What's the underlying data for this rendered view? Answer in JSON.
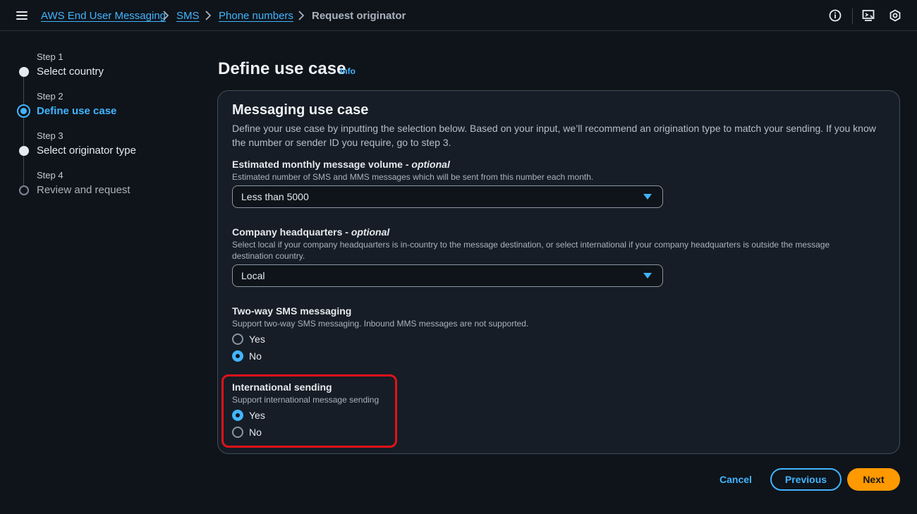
{
  "breadcrumb": {
    "items": [
      "AWS End User Messaging",
      "SMS",
      "Phone numbers"
    ],
    "current": "Request originator"
  },
  "topbar_icons": [
    "info-icon",
    "cloudshell-icon",
    "settings-icon"
  ],
  "steps": [
    {
      "step": "Step 1",
      "title": "Select country",
      "state": "completed"
    },
    {
      "step": "Step 2",
      "title": "Define use case",
      "state": "active"
    },
    {
      "step": "Step 3",
      "title": "Select originator type",
      "state": "completed"
    },
    {
      "step": "Step 4",
      "title": "Review and request",
      "state": "pending"
    }
  ],
  "page": {
    "title": "Define use case",
    "info": "Info"
  },
  "panel": {
    "title": "Messaging use case",
    "description": "Define your use case by inputting the selection below. Based on your input, we’ll recommend an origination type to match your sending. If you know the number or sender ID you require, go to step 3.",
    "volume": {
      "label": "Estimated monthly message volume - ",
      "optional": "optional",
      "hint": "Estimated number of SMS and MMS messages which will be sent from this number each month.",
      "value": "Less than 5000"
    },
    "headquarters": {
      "label": "Company headquarters - ",
      "optional": "optional",
      "hint": "Select local if your company headquarters is in-country to the message destination, or select international if your company headquarters is outside the message destination country.",
      "value": "Local"
    },
    "two_way": {
      "label": "Two-way SMS messaging",
      "hint": "Support two-way SMS messaging. Inbound MMS messages are not supported.",
      "options": [
        "Yes",
        "No"
      ],
      "selected": "No"
    },
    "international": {
      "label": "International sending",
      "hint": "Support international message sending",
      "options": [
        "Yes",
        "No"
      ],
      "selected": "Yes"
    }
  },
  "footer": {
    "cancel": "Cancel",
    "previous": "Previous",
    "next": "Next"
  },
  "colors": {
    "accent": "#42b4ff",
    "primary_button": "#ff9900",
    "highlight": "#e0121b",
    "background": "#0f141a"
  }
}
